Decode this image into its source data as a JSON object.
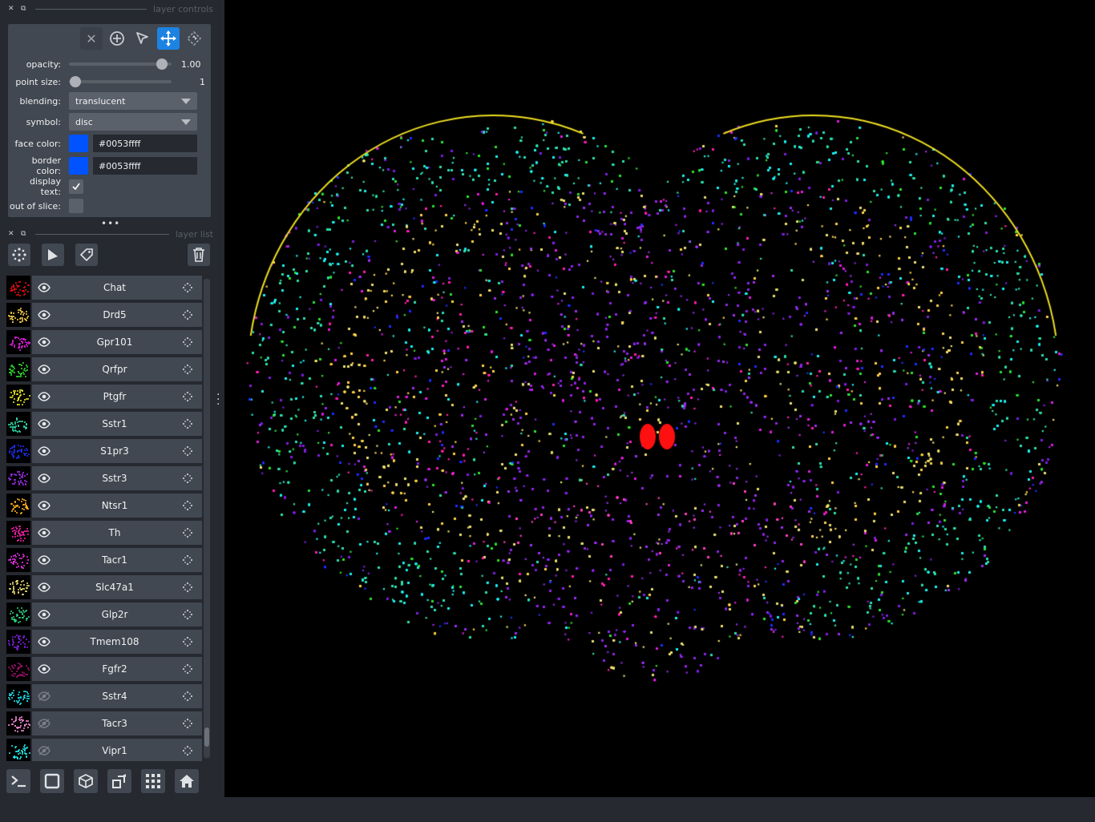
{
  "layer_controls": {
    "title": "layer controls",
    "mode_buttons": [
      {
        "icon": "close-icon",
        "selected": false
      },
      {
        "icon": "add-point-icon",
        "selected": false
      },
      {
        "icon": "select-arrow-icon",
        "selected": false
      },
      {
        "icon": "pan-zoom-icon",
        "selected": true
      },
      {
        "icon": "transform-icon",
        "selected": false
      }
    ],
    "opacity_label": "opacity:",
    "opacity_value": "1.00",
    "opacity_level": 1.0,
    "point_size_label": "point size:",
    "point_size_value": "1",
    "point_size_level": 0.0,
    "blending_label": "blending:",
    "blending_value": "translucent",
    "symbol_label": "symbol:",
    "symbol_value": "disc",
    "face_color_label": "face color:",
    "face_color_value": "#0053ffff",
    "border_color_label": "border color:",
    "border_color_value": "#0053ffff",
    "display_text_label": "display text:",
    "display_text_checked": true,
    "out_of_slice_label": "out of slice:",
    "out_of_slice_checked": false
  },
  "layer_list": {
    "title": "layer list",
    "buttons": [
      "points-icon",
      "shapes-icon",
      "labels-icon",
      "delete-icon"
    ],
    "layers": [
      {
        "name": "Chat",
        "visible": true,
        "color": "#e01010"
      },
      {
        "name": "Drd5",
        "visible": true,
        "color": "#ffd24a"
      },
      {
        "name": "Gpr101",
        "visible": true,
        "color": "#e020e0"
      },
      {
        "name": "Qrfpr",
        "visible": true,
        "color": "#30e030"
      },
      {
        "name": "Ptgfr",
        "visible": true,
        "color": "#f0f020"
      },
      {
        "name": "Sstr1",
        "visible": true,
        "color": "#30e0b0"
      },
      {
        "name": "S1pr3",
        "visible": true,
        "color": "#2030ff"
      },
      {
        "name": "Sstr3",
        "visible": true,
        "color": "#a030f0"
      },
      {
        "name": "Ntsr1",
        "visible": true,
        "color": "#ffb020"
      },
      {
        "name": "Th",
        "visible": true,
        "color": "#ff20b0"
      },
      {
        "name": "Tacr1",
        "visible": true,
        "color": "#e030e0"
      },
      {
        "name": "Slc47a1",
        "visible": true,
        "color": "#f0e070"
      },
      {
        "name": "Glp2r",
        "visible": true,
        "color": "#30d080"
      },
      {
        "name": "Tmem108",
        "visible": true,
        "color": "#8020e0"
      },
      {
        "name": "Fgfr2",
        "visible": true,
        "color": "#a01070"
      },
      {
        "name": "Sstr4",
        "visible": false,
        "color": "#20e0f0"
      },
      {
        "name": "Tacr3",
        "visible": false,
        "color": "#ff90e0"
      },
      {
        "name": "Vipr1",
        "visible": false,
        "color": "#20f0f0"
      }
    ]
  },
  "bottom_buttons": [
    "console-icon",
    "ndisplay-square-icon",
    "3d-cube-icon",
    "roll-dims-icon",
    "grid-icon",
    "home-icon"
  ]
}
